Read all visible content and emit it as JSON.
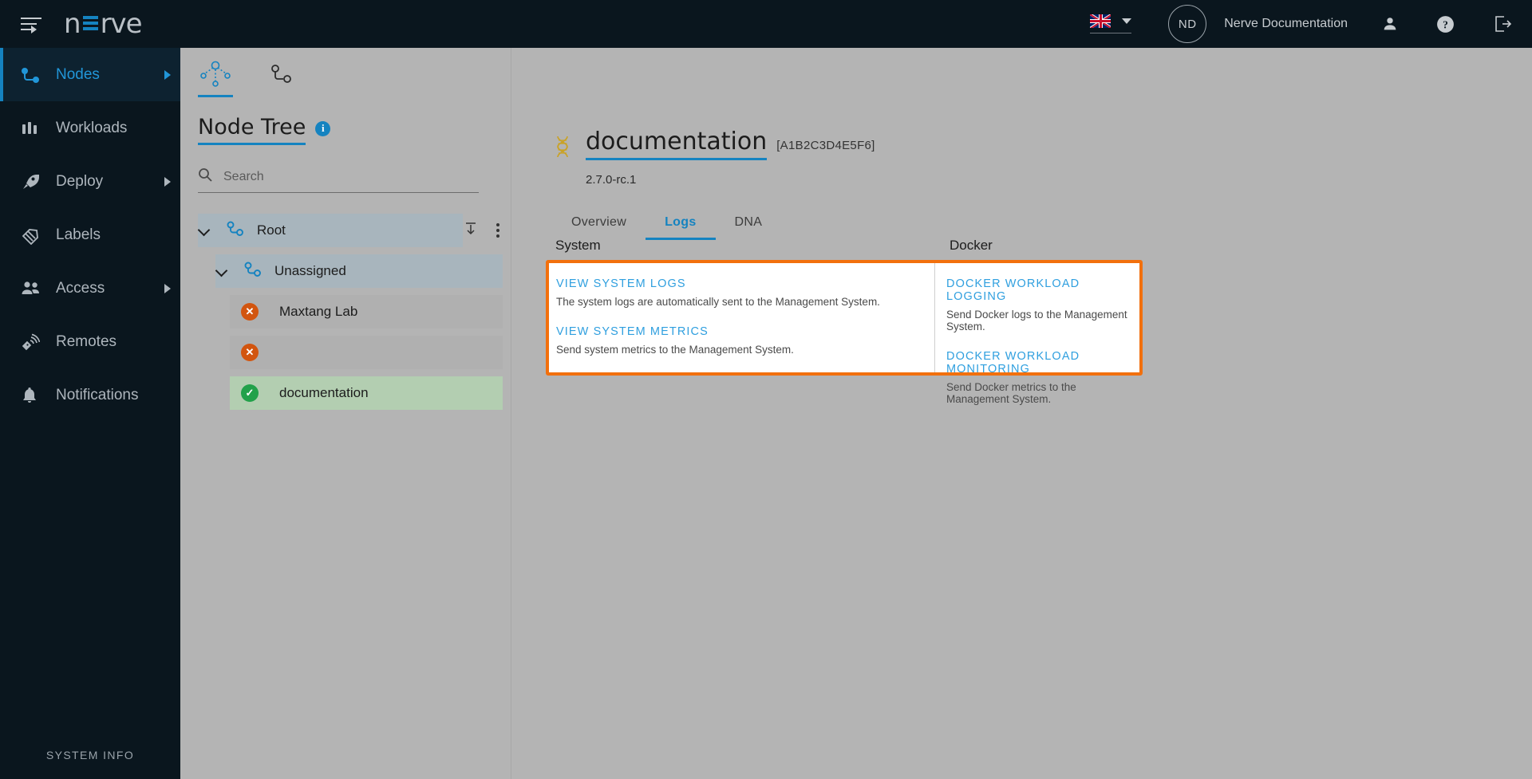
{
  "topbar": {
    "menu_icon": "hamburger-icon",
    "logo_text_left": "n",
    "logo_text_right": "rve",
    "language": "en-gb",
    "avatar_initials": "ND",
    "username": "Nerve Documentation",
    "user_icon": "person-icon",
    "help_icon": "question-mark-icon",
    "logout_icon": "logout-icon"
  },
  "sidebar": {
    "items": [
      {
        "label": "Nodes",
        "icon": "nodes-icon",
        "active": true,
        "expandable": true
      },
      {
        "label": "Workloads",
        "icon": "workloads-icon",
        "active": false,
        "expandable": false
      },
      {
        "label": "Deploy",
        "icon": "rocket-icon",
        "active": false,
        "expandable": true
      },
      {
        "label": "Labels",
        "icon": "tag-icon",
        "active": false,
        "expandable": false
      },
      {
        "label": "Access",
        "icon": "people-icon",
        "active": false,
        "expandable": true
      },
      {
        "label": "Remotes",
        "icon": "remote-icon",
        "active": false,
        "expandable": false
      },
      {
        "label": "Notifications",
        "icon": "bell-icon",
        "active": false,
        "expandable": false
      }
    ],
    "footer_label": "SYSTEM INFO"
  },
  "tree_panel": {
    "tabs": [
      {
        "name": "node-tree-tab",
        "icon": "hierarchy-icon",
        "active": true
      },
      {
        "name": "node-list-tab",
        "icon": "node-link-icon",
        "active": false
      }
    ],
    "title": "Node Tree",
    "info_icon": "info-icon",
    "search": {
      "placeholder": "Search",
      "value": ""
    },
    "rows": [
      {
        "label": "Root",
        "type": "root",
        "icon": "node-link-icon",
        "expanded": true,
        "actions": [
          "collapse-all-icon",
          "kebab-menu-icon"
        ]
      },
      {
        "label": "Unassigned",
        "type": "group",
        "icon": "node-link-icon",
        "expanded": true
      },
      {
        "label": "Maxtang Lab",
        "type": "node",
        "status": "error",
        "status_glyph": "✕"
      },
      {
        "label": "",
        "type": "node",
        "status": "error",
        "status_glyph": "✕",
        "redacted": true
      },
      {
        "label": "documentation",
        "type": "node",
        "status": "online",
        "status_glyph": "✓",
        "selected": true
      }
    ]
  },
  "main": {
    "node_icon": "dna-icon",
    "node_title": "documentation",
    "node_serial": "[A1B2C3D4E5F6]",
    "node_version": "2.7.0-rc.1",
    "tabs": [
      {
        "label": "Overview",
        "active": false
      },
      {
        "label": "Logs",
        "active": true
      },
      {
        "label": "DNA",
        "active": false
      }
    ],
    "logs": {
      "system_header": "System",
      "docker_header": "Docker",
      "system_entries": [
        {
          "link": "VIEW SYSTEM LOGS",
          "desc": "The system logs are automatically sent to the Management System."
        },
        {
          "link": "VIEW SYSTEM METRICS",
          "desc": "Send system metrics to the Management System."
        }
      ],
      "docker_entries": [
        {
          "link": "DOCKER WORKLOAD LOGGING",
          "desc": "Send Docker logs to the Management System."
        },
        {
          "link": "DOCKER WORKLOAD MONITORING",
          "desc": "Send Docker metrics to the Management System."
        }
      ]
    }
  },
  "colors": {
    "topbar_bg": "#0a161e",
    "accent_blue": "#1583c0",
    "highlight_orange": "#f2700d",
    "page_bg": "#b4b4b4",
    "status_error": "#d2550f",
    "status_ok": "#22a14a",
    "dna_gold": "#c9a227"
  }
}
